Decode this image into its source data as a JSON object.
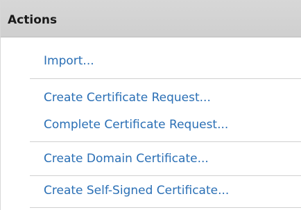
{
  "panel": {
    "title": "Actions",
    "actions": [
      "Import...",
      "Create Certificate Request...",
      "Complete Certificate Request...",
      "Create Domain Certificate...",
      "Create Self-Signed Certificate..."
    ]
  },
  "colors": {
    "header_background": "#d3d3d3",
    "link": "#2a6fb5",
    "separator": "#d0d0d0"
  }
}
